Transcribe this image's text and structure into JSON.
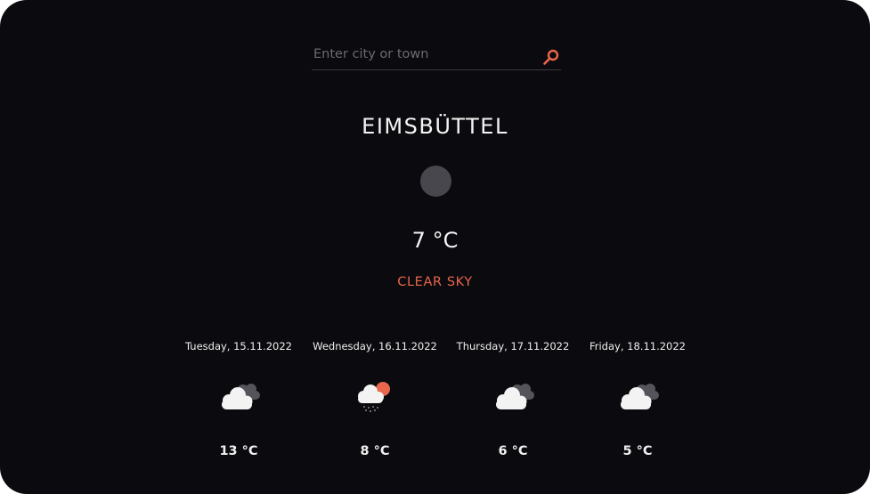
{
  "search": {
    "placeholder": "Enter city or town",
    "value": "",
    "button_icon": "search-icon"
  },
  "current": {
    "city": "EIMSBÜTTEL",
    "icon": "weather-icon-placeholder",
    "temperature": "7 °C",
    "condition": "CLEAR SKY"
  },
  "forecast": [
    {
      "date": "Tuesday, 15.11.2022",
      "icon": "cloudy-icon",
      "temperature": "13 °C"
    },
    {
      "date": "Wednesday, 16.11.2022",
      "icon": "sun-cloud-rain-icon",
      "temperature": "8 °C"
    },
    {
      "date": "Thursday, 17.11.2022",
      "icon": "cloudy-icon",
      "temperature": "6 °C"
    },
    {
      "date": "Friday, 18.11.2022",
      "icon": "cloudy-icon",
      "temperature": "5 °C"
    }
  ],
  "colors": {
    "background": "#0b0a0e",
    "accent": "#e8674d",
    "text": "#f4f4f4",
    "muted": "#6a6a72"
  }
}
